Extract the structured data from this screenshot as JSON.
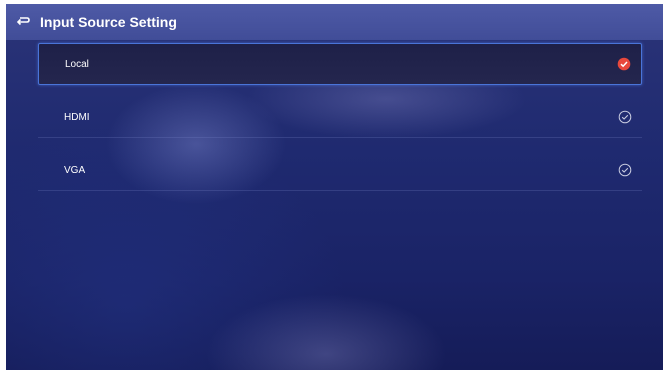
{
  "header": {
    "title": "Input Source Setting",
    "back_icon": "return-arrow-icon"
  },
  "sources": [
    {
      "label": "Local",
      "selected": true
    },
    {
      "label": "HDMI",
      "selected": false
    },
    {
      "label": "VGA",
      "selected": false
    }
  ],
  "colors": {
    "header_bg": "#4a56a2",
    "selected_check": "#e8483c",
    "selected_border": "#4a74d8"
  }
}
